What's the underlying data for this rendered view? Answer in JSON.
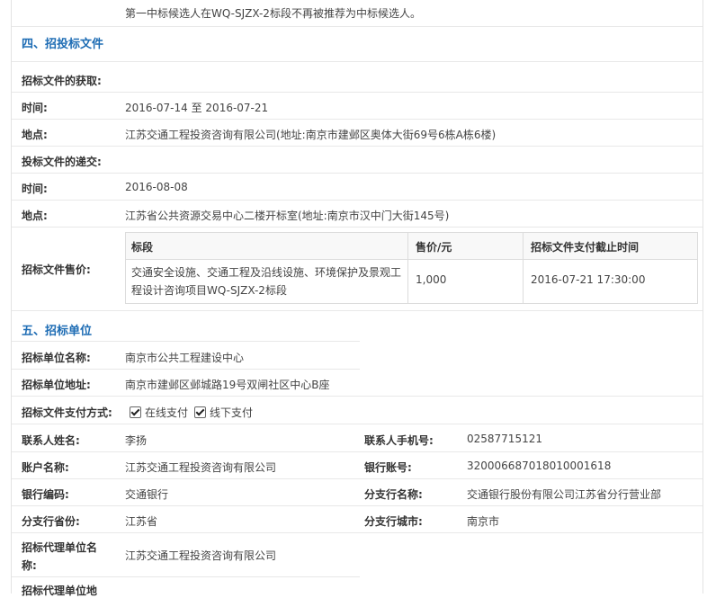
{
  "top_note": "第一中标候选人在WQ-SJZX-2标段不再被推荐为中标候选人。",
  "section4": {
    "title": "四、招投标文件",
    "obtain_label": "招标文件的获取:",
    "obtain_time_label": "时间:",
    "obtain_time_start": "2016-07-14",
    "obtain_time_sep": "至",
    "obtain_time_end": "2016-07-21",
    "obtain_place_label": "地点:",
    "obtain_place": "江苏交通工程投资咨询有限公司(地址:南京市建邺区奥体大街69号6栋A栋6楼)",
    "submit_label": "投标文件的递交:",
    "submit_time_label": "时间:",
    "submit_time": "2016-08-08",
    "submit_place_label": "地点:",
    "submit_place": "江苏省公共资源交易中心二楼开标室(地址:南京市汉中门大街145号)",
    "price_label": "招标文件售价:",
    "price_table": {
      "headers": [
        "标段",
        "售价/元",
        "招标文件支付截止时间"
      ],
      "row": [
        "交通安全设施、交通工程及沿线设施、环境保护及景观工程设计咨询项目WQ-SJZX-2标段",
        "1,000",
        "2016-07-21 17:30:00"
      ]
    }
  },
  "section5": {
    "title": "五、招标单位",
    "name_label": "招标单位名称:",
    "name": "南京市公共工程建设中心",
    "address_label": "招标单位地址:",
    "address": "南京市建邺区邺城路19号双闸社区中心B座",
    "pay_label": "招标文件支付方式:",
    "pay_online": "在线支付",
    "pay_offline": "线下支付",
    "contact_label": "联系人姓名:",
    "contact": "李扬",
    "phone_label": "联系人手机号:",
    "phone": "02587715121",
    "account_name_label": "账户名称:",
    "account_name": "江苏交通工程投资咨询有限公司",
    "account_no_label": "银行账号:",
    "account_no": "32000668701801000161​8",
    "bank_code_label": "银行编码:",
    "bank_code": "交通银行",
    "branch_name_label": "分支行名称:",
    "branch_name": "交通银行股份有限公司江苏省分行营业部",
    "branch_prov_label": "分支行省份:",
    "branch_prov": "江苏省",
    "branch_city_label": "分支行城市:",
    "branch_city": "南京市",
    "agent_name_label": "招标代理单位名称:",
    "agent_name": "江苏交通工程投资咨询有限公司",
    "agent_addr_label": "招标代理单位地"
  }
}
